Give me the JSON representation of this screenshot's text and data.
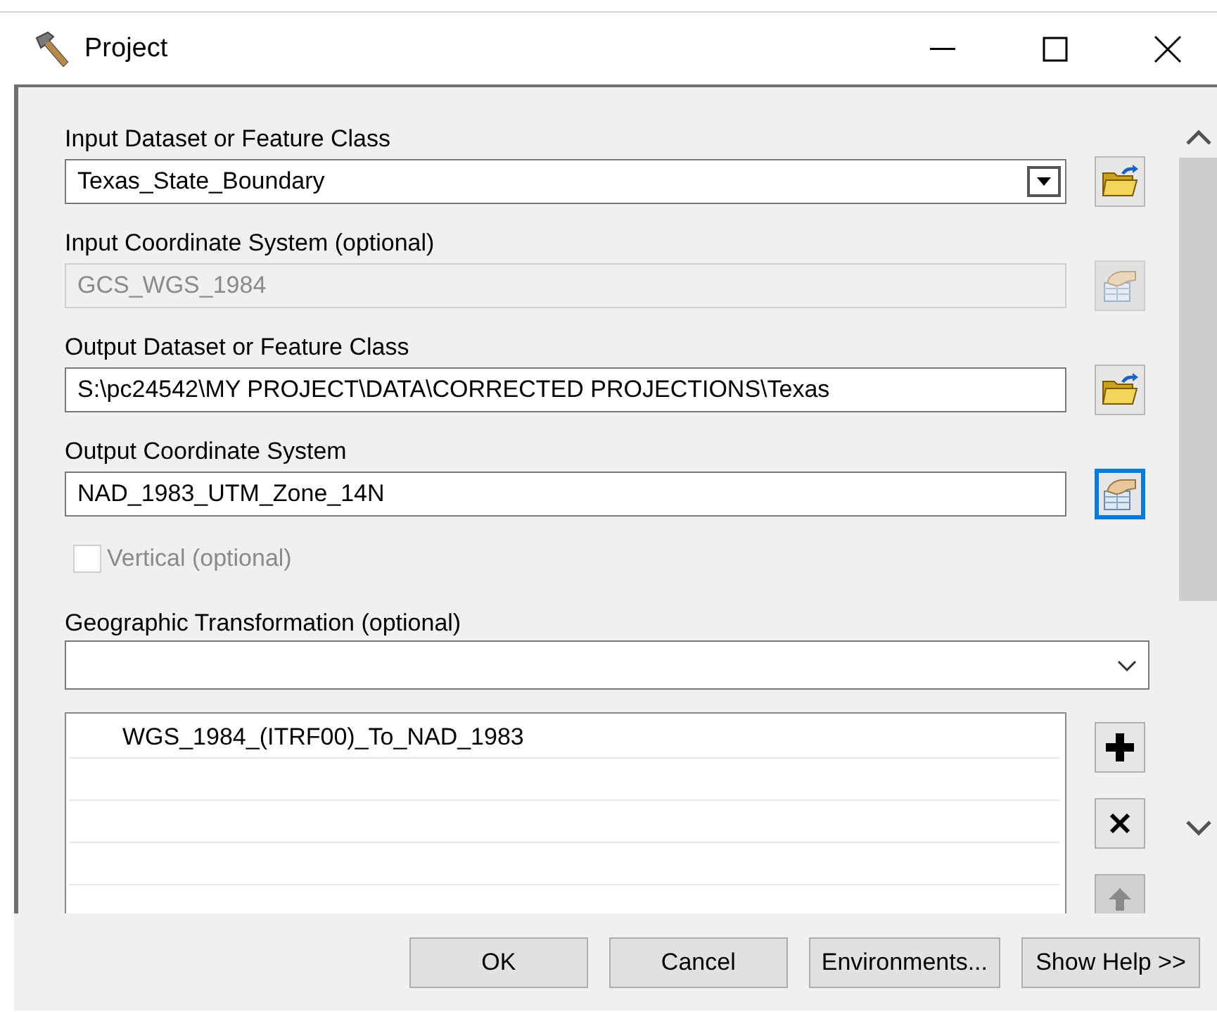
{
  "window": {
    "title": "Project"
  },
  "params": [
    {
      "kind": "combo",
      "label": "Input Dataset or Feature Class",
      "value": "Texas_State_Boundary",
      "disabled": false,
      "browse_folder": true,
      "focused": false
    },
    {
      "kind": "text",
      "label": "Input Coordinate System (optional)",
      "value": "GCS_WGS_1984",
      "disabled": true,
      "browse_folder": false,
      "focused": false
    },
    {
      "kind": "text",
      "label": "Output Dataset or Feature Class",
      "value": "S:\\pc24542\\MY PROJECT\\DATA\\CORRECTED PROJECTIONS\\Texas",
      "disabled": false,
      "browse_folder": true,
      "focused": false
    },
    {
      "kind": "text",
      "label": "Output Coordinate System",
      "value": "NAD_1983_UTM_Zone_14N",
      "disabled": false,
      "browse_folder": false,
      "focused": true
    }
  ],
  "vertical": {
    "label": "Vertical (optional)",
    "checked": false,
    "disabled": true
  },
  "transformation": {
    "label": "Geographic Transformation (optional)",
    "items": [
      "WGS_1984_(ITRF00)_To_NAD_1983"
    ],
    "tools": [
      {
        "kind": "add",
        "disabled": false
      },
      {
        "kind": "remove",
        "disabled": false
      },
      {
        "kind": "up",
        "disabled": true
      }
    ]
  },
  "buttons": [
    "OK",
    "Cancel",
    "Environments...",
    "Show Help >>"
  ]
}
